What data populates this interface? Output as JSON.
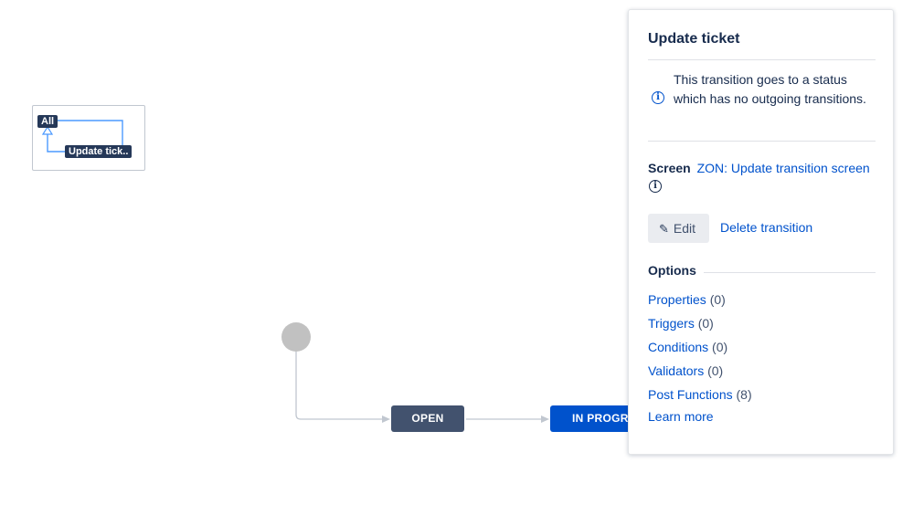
{
  "minimap": {
    "all_label": "All",
    "transition_label": "Update tick.."
  },
  "workflow": {
    "statuses": [
      {
        "label": "OPEN",
        "color": "#42526e"
      },
      {
        "label": "IN PROGRE",
        "color": "#0052cc"
      }
    ],
    "start_node_color": "#c1c1c1"
  },
  "panel": {
    "title": "Update ticket",
    "info_message": "This transition goes to a status which has no outgoing transitions.",
    "screen_label": "Screen",
    "screen_link": "ZON: Update transition screen",
    "edit_label": "Edit",
    "delete_label": "Delete transition",
    "options_title": "Options",
    "options": [
      {
        "label": "Properties",
        "count": "(0)"
      },
      {
        "label": "Triggers",
        "count": "(0)"
      },
      {
        "label": "Conditions",
        "count": "(0)"
      },
      {
        "label": "Validators",
        "count": "(0)"
      },
      {
        "label": "Post Functions",
        "count": "(8)"
      }
    ],
    "learn_more": "Learn more",
    "link_color": "#0052cc"
  }
}
